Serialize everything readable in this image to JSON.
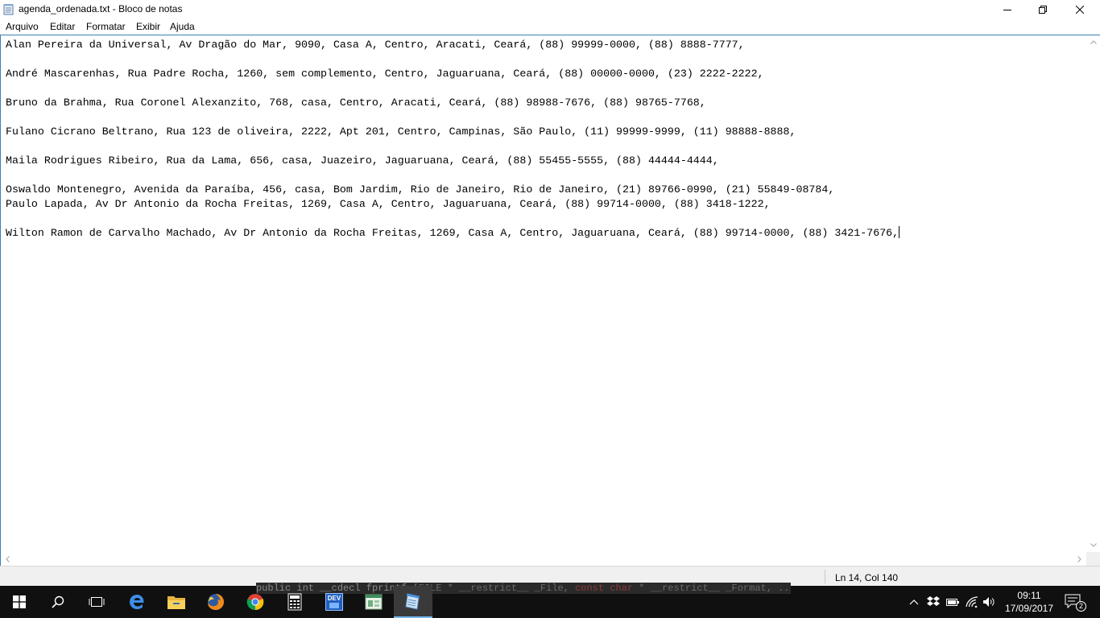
{
  "window": {
    "title": "agenda_ordenada.txt - Bloco de notas",
    "icon": "notepad-icon",
    "controls": [
      "minimize-icon",
      "maximize-icon",
      "close-icon"
    ]
  },
  "menu": {
    "items": [
      "Arquivo",
      "Editar",
      "Formatar",
      "Exibir",
      "Ajuda"
    ]
  },
  "document": {
    "lines": [
      "Alan Pereira da Universal, Av Dragão do Mar, 9090, Casa A, Centro, Aracati, Ceará, (88) 99999-0000, (88) 8888-7777,",
      "",
      "André Mascarenhas, Rua Padre Rocha, 1260, sem complemento, Centro, Jaguaruana, Ceará, (88) 00000-0000, (23) 2222-2222,",
      "",
      "Bruno da Brahma, Rua Coronel Alexanzito, 768, casa, Centro, Aracati, Ceará, (88) 98988-7676, (88) 98765-7768,",
      "",
      "Fulano Cicrano Beltrano, Rua 123 de oliveira, 2222, Apt 201, Centro, Campinas, São Paulo, (11) 99999-9999, (11) 98888-8888,",
      "",
      "Maila Rodrigues Ribeiro, Rua da Lama, 656, casa, Juazeiro, Jaguaruana, Ceará, (88) 55455-5555, (88) 44444-4444,",
      "",
      "Oswaldo Montenegro, Avenida da Paraíba, 456, casa, Bom Jardim, Rio de Janeiro, Rio de Janeiro, (21) 89766-0990, (21) 55849-08784,",
      "Paulo Lapada, Av Dr Antonio da Rocha Freitas, 1269, Casa A, Centro, Jaguaruana, Ceará, (88) 99714-0000, (88) 3418-1222,",
      "",
      "Wilton Ramon de Carvalho Machado, Av Dr Antonio da Rocha Freitas, 1269, Casa A, Centro, Jaguaruana, Ceará, (88) 99714-0000, (88) 3421-7676,"
    ]
  },
  "status": {
    "position": "Ln 14, Col 140"
  },
  "background_peek": {
    "code_prefix": "public int __cdecl fprintf (",
    "code_file": "FILE * __restrict__ _File, ",
    "code_keyword": "const char",
    "code_rest": " * __restrict__ _Format, ...)"
  },
  "taskbar": {
    "apps": [
      {
        "name": "start-button",
        "icon": "windows-logo-icon"
      },
      {
        "name": "search-button",
        "icon": "search-icon"
      },
      {
        "name": "task-view-button",
        "icon": "task-view-icon"
      },
      {
        "name": "taskbar-edge",
        "icon": "edge-icon"
      },
      {
        "name": "taskbar-file-explorer",
        "icon": "folder-icon"
      },
      {
        "name": "taskbar-firefox",
        "icon": "firefox-icon"
      },
      {
        "name": "taskbar-chrome",
        "icon": "chrome-icon"
      },
      {
        "name": "taskbar-calculator",
        "icon": "calculator-icon"
      },
      {
        "name": "taskbar-devcpp",
        "icon": "devcpp-icon",
        "label": "DEV"
      },
      {
        "name": "taskbar-app",
        "icon": "window-app-icon"
      },
      {
        "name": "taskbar-notepad",
        "icon": "notepad-icon",
        "active": true
      }
    ],
    "tray": [
      "chevron-up-icon",
      "dropbox-icon",
      "battery-icon",
      "wifi-icon",
      "volume-icon"
    ],
    "clock": {
      "time": "09:11",
      "date": "17/09/2017"
    },
    "notifications_count": "2",
    "colors": {
      "taskbar_bg": "#101010",
      "active_indicator": "#76b9ed",
      "editor_border": "#3c7fb1"
    }
  }
}
